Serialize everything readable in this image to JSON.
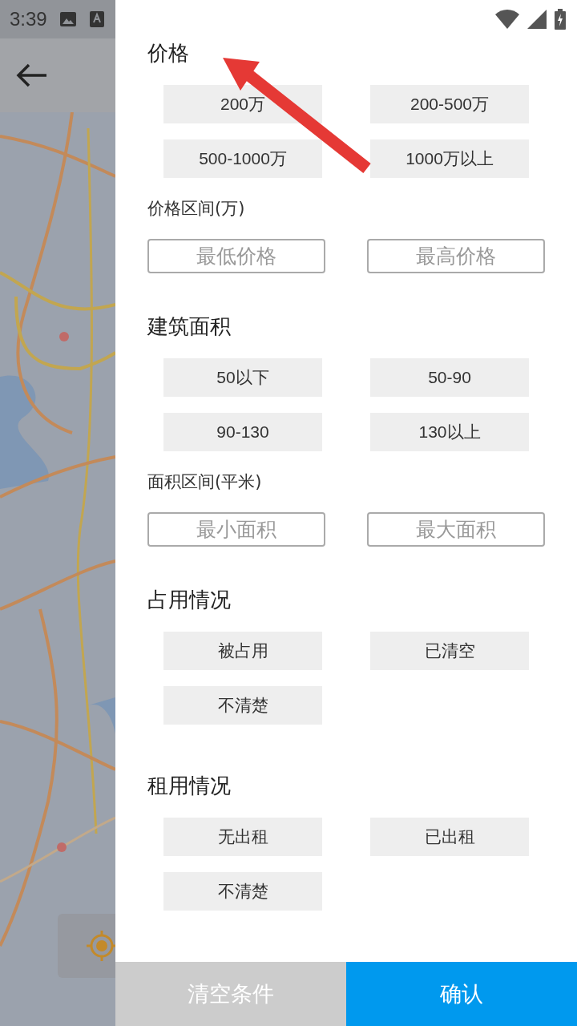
{
  "status_bar": {
    "time": "3:39"
  },
  "sections": [
    {
      "title": "价格",
      "options": [
        {
          "label": "200万",
          "selected": false
        },
        {
          "label": "200-500万",
          "selected": false
        },
        {
          "label": "500-1000万",
          "selected": false
        },
        {
          "label": "1000万以上",
          "selected": false
        }
      ],
      "range": {
        "label": "价格区间(万)",
        "fields": [
          {
            "placeholder": "最低价格"
          },
          {
            "placeholder": "最高价格"
          }
        ]
      }
    },
    {
      "title": "建筑面积",
      "options": [
        {
          "label": "50以下",
          "selected": false
        },
        {
          "label": "50-90",
          "selected": false
        },
        {
          "label": "90-130",
          "selected": false
        },
        {
          "label": "130以上",
          "selected": false
        }
      ],
      "range": {
        "label": "面积区间(平米)",
        "fields": [
          {
            "placeholder": "最小面积"
          },
          {
            "placeholder": "最大面积"
          }
        ]
      }
    },
    {
      "title": "占用情况",
      "options": [
        {
          "label": "被占用",
          "selected": false
        },
        {
          "label": "已清空",
          "selected": false
        },
        {
          "label": "不清楚",
          "selected": false
        }
      ]
    },
    {
      "title": "租用情况",
      "options": [
        {
          "label": "无出租",
          "selected": false
        },
        {
          "label": "已出租",
          "selected": false
        },
        {
          "label": "不清楚",
          "selected": false
        }
      ]
    }
  ],
  "footer": {
    "buttons": [
      {
        "label": "清空条件",
        "kind": "secondary"
      },
      {
        "label": "确认",
        "kind": "primary"
      }
    ]
  }
}
